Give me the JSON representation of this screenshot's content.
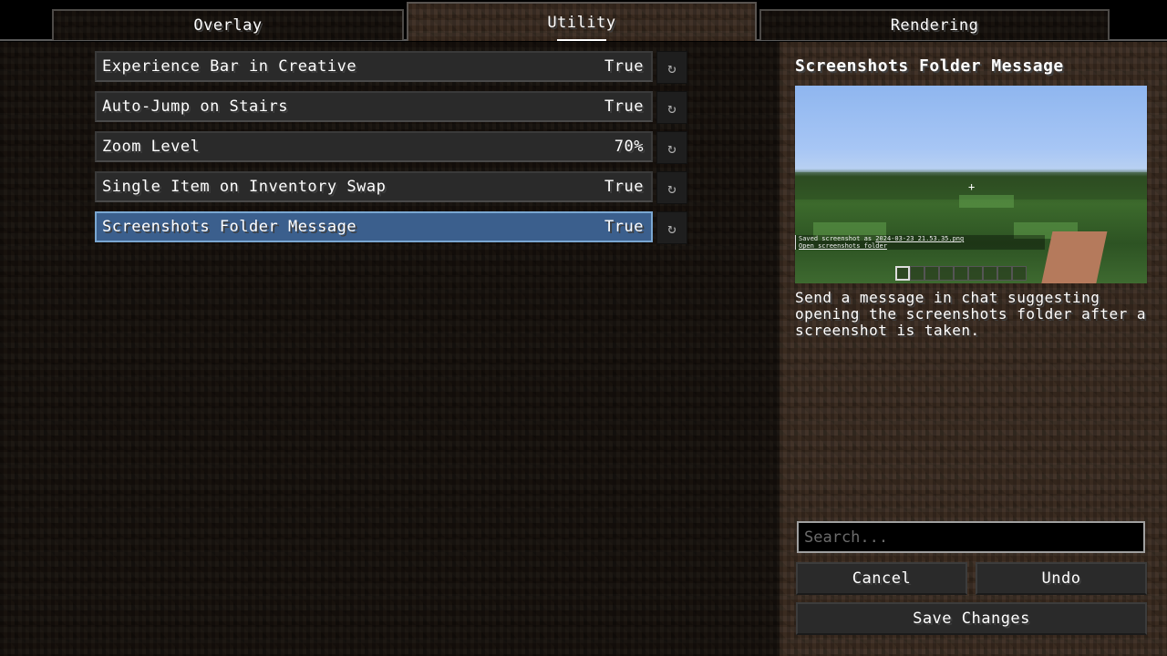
{
  "tabs": [
    {
      "label": "Overlay",
      "active": false
    },
    {
      "label": "Utility",
      "active": true
    },
    {
      "label": "Rendering",
      "active": false
    }
  ],
  "options": [
    {
      "label": "Experience Bar in Creative",
      "value": "True",
      "selected": false
    },
    {
      "label": "Auto-Jump on Stairs",
      "value": "True",
      "selected": false
    },
    {
      "label": "Zoom Level",
      "value": "70%",
      "selected": false
    },
    {
      "label": "Single Item on Inventory Swap",
      "value": "True",
      "selected": false
    },
    {
      "label": "Screenshots Folder Message",
      "value": "True",
      "selected": true
    }
  ],
  "reset_icon": "reset-icon",
  "detail": {
    "title": "Screenshots Folder Message",
    "preview": {
      "chat_line1_prefix": "Saved screenshot as ",
      "chat_line1_file": "2024-03-23_21.53.35.png",
      "chat_line2": "Open screenshots folder"
    },
    "description": "Send a message in chat suggesting opening the screenshots folder after a screenshot is taken."
  },
  "search": {
    "placeholder": "Search...",
    "value": ""
  },
  "buttons": {
    "cancel": "Cancel",
    "undo": "Undo",
    "save": "Save Changes"
  },
  "colors": {
    "selected_row": "#3b5f8d",
    "selected_border": "#7aa7d2"
  }
}
